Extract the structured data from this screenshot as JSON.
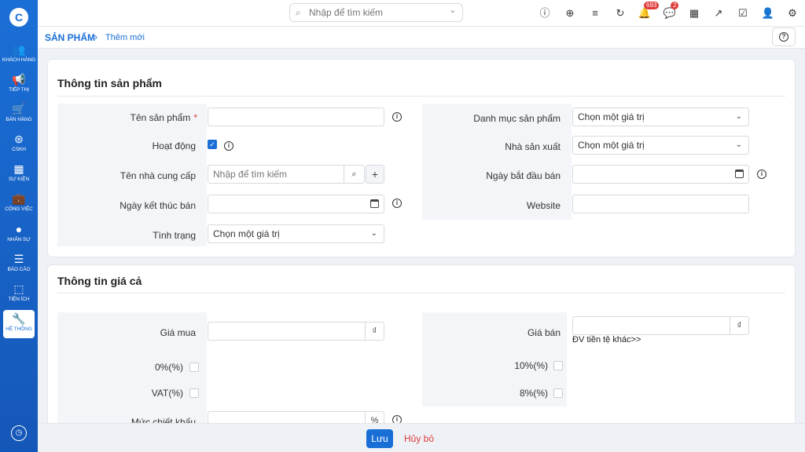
{
  "sidebar": {
    "logo_icon": "logo-c-icon",
    "items": [
      {
        "label": "KHÁCH HÀNG",
        "icon": "users-icon",
        "glyph": "👥"
      },
      {
        "label": "TIẾP THỊ",
        "icon": "megaphone-icon",
        "glyph": "📢"
      },
      {
        "label": "BÁN HÀNG",
        "icon": "cart-icon",
        "glyph": "🛒"
      },
      {
        "label": "CSKH",
        "icon": "lifebuoy-icon",
        "glyph": "⊛"
      },
      {
        "label": "SỰ KIỆN",
        "icon": "calendar-icon",
        "glyph": "▦"
      },
      {
        "label": "CÔNG VIỆC",
        "icon": "briefcase-icon",
        "glyph": "💼"
      },
      {
        "label": "NHÂN SỰ",
        "icon": "person-icon",
        "glyph": "●"
      },
      {
        "label": "BÁO CÁO",
        "icon": "report-icon",
        "glyph": "☰"
      },
      {
        "label": "TIỆN ÍCH",
        "icon": "boxes-icon",
        "glyph": "⬚"
      },
      {
        "label": "HỆ THỐNG",
        "icon": "wrench-icon",
        "glyph": "🔧",
        "active": true
      }
    ],
    "bottom_icon": "clock-icon"
  },
  "topbar": {
    "search_placeholder": "Nhập để tìm kiếm",
    "notifications_count": "693",
    "messages_count": "2",
    "icons": [
      "alert-icon",
      "add-icon",
      "list-icon",
      "refresh-icon",
      "bell-icon",
      "chat-icon",
      "calendar-icon",
      "chart-icon",
      "check-icon",
      "user-icon",
      "settings-icon"
    ]
  },
  "breadcrumb": {
    "main": "SẢN PHẨM",
    "sep": "›",
    "sub": "Thêm mới",
    "help": "?"
  },
  "product_info": {
    "title": "Thông tin sản phẩm",
    "name_label": "Tên sản phẩm",
    "required_mark": "*",
    "active_label": "Hoạt động",
    "active_checked": true,
    "supplier_label": "Tên nhà cung cấp",
    "supplier_placeholder": "Nhập để tìm kiếm",
    "end_date_label": "Ngày kết thúc bán",
    "status_label": "Tình trạng",
    "status_value": "Chọn một giá trị",
    "category_label": "Danh mục sản phẩm",
    "category_value": "Chọn một giá trị",
    "manufacturer_label": "Nhà sản xuất",
    "manufacturer_value": "Chọn một giá trị",
    "start_date_label": "Ngày bắt đầu bán",
    "website_label": "Website"
  },
  "price_info": {
    "title": "Thông tin giá cả",
    "buy_price_label": "Giá mua",
    "currency": "₫",
    "sell_price_label": "Giá bán",
    "other_currency_link": "ĐV tiền tệ khác>>",
    "tax0_label": "0%(%)",
    "tax10_label": "10%(%)",
    "vat_label": "VAT(%)",
    "tax8_label": "8%(%)",
    "discount_label": "Mức chiết khấu",
    "percent": "%"
  },
  "actions": {
    "save": "Lưu",
    "cancel": "Hủy bỏ"
  }
}
